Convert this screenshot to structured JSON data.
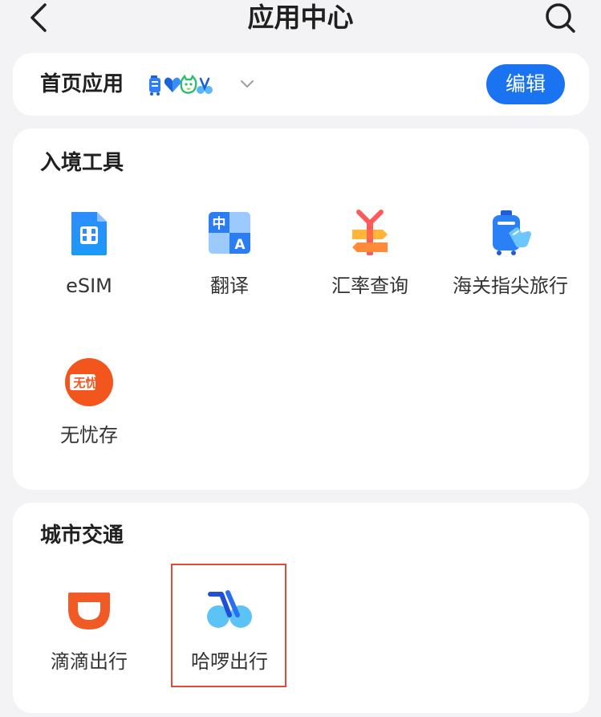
{
  "header": {
    "title": "应用中心"
  },
  "home_apps": {
    "title": "首页应用",
    "edit_label": "编辑",
    "preview_icons": [
      "luggage-icon",
      "heart-icon",
      "cat-icon",
      "bike-icon"
    ]
  },
  "tools": {
    "title": "入境工具",
    "items": [
      {
        "label": "eSIM",
        "icon": "sim-card-icon"
      },
      {
        "label": "翻译",
        "icon": "translate-icon"
      },
      {
        "label": "汇率查询",
        "icon": "exchange-rate-icon"
      },
      {
        "label": "海关指尖旅行",
        "icon": "customs-luggage-icon"
      },
      {
        "label": "无忧存",
        "icon": "storage-badge-icon",
        "badge_text": "无忧存"
      }
    ]
  },
  "traffic": {
    "title": "城市交通",
    "items": [
      {
        "label": "滴滴出行",
        "icon": "didi-icon"
      },
      {
        "label": "哈啰出行",
        "icon": "hello-bike-icon"
      }
    ]
  },
  "colors": {
    "accent": "#1a73f0",
    "background": "#f3f3f5",
    "card": "#ffffff",
    "didi_orange": "#f15a24",
    "highlight": "#e24a3a"
  }
}
